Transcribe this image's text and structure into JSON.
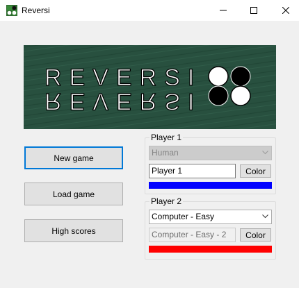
{
  "window": {
    "title": "Reversi",
    "controls": [
      "minimize",
      "maximize",
      "close"
    ]
  },
  "banner": {
    "title": "REVERSI",
    "background_color": "#28503f"
  },
  "menu": {
    "new_game": "New game",
    "load_game": "Load game",
    "high_scores": "High scores"
  },
  "player1": {
    "group_label": "Player 1",
    "type_value": "Human",
    "type_enabled": false,
    "name_value": "Player 1",
    "color_button": "Color",
    "color": "#0000ff"
  },
  "player2": {
    "group_label": "Player 2",
    "type_value": "Computer - Easy",
    "type_enabled": true,
    "name_value": "Computer - Easy - 2",
    "name_enabled": false,
    "color_button": "Color",
    "color": "#ff0000"
  }
}
